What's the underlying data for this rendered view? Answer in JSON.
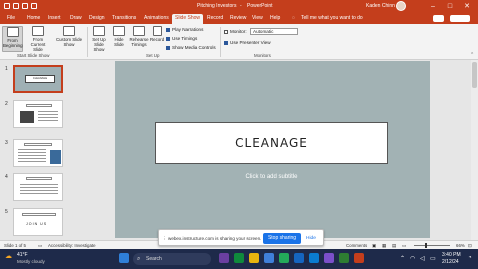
{
  "window": {
    "title": "Pitching Investors",
    "app": "PowerPoint",
    "search_text": "Tell me what you want to do",
    "user": "Kaden Chinn"
  },
  "tabs": [
    "File",
    "Home",
    "Insert",
    "Draw",
    "Design",
    "Transitions",
    "Animations",
    "Slide Show",
    "Record",
    "Review",
    "View",
    "Help"
  ],
  "ribbon": {
    "start_group": {
      "label": "Start Slide Show",
      "from_beginning": "From Beginning",
      "from_current": "From Current Slide",
      "custom": "Custom Slide Show"
    },
    "setup_group": {
      "label": "Set Up",
      "setup": "Set Up Slide Show",
      "hide": "Hide Slide",
      "rehearse": "Rehearse Timings",
      "record": "Record",
      "play_narrations": "Play Narrations",
      "use_timings": "Use Timings",
      "show_media_controls": "Show Media Controls"
    },
    "monitors_group": {
      "label": "Monitors",
      "monitor_label": "Monitor:",
      "monitor_value": "Automatic",
      "use_presenter_view": "Use Presenter View"
    }
  },
  "thumbnails": [
    {
      "num": "1",
      "title": "CLEANAGE"
    },
    {
      "num": "2",
      "title": ""
    },
    {
      "num": "3",
      "title": ""
    },
    {
      "num": "4",
      "title": ""
    },
    {
      "num": "5",
      "title": "JOIN US"
    }
  ],
  "slide": {
    "title": "CLEANAGE",
    "subtitle_placeholder": "Click to add subtitle"
  },
  "statusbar": {
    "slide_info": "Slide 1 of 5",
    "accessibility": "Accessibility: Investigate",
    "comments": "Comments",
    "zoom": "66%"
  },
  "share": {
    "message": "webex.instructure.com is sharing your screen.",
    "stop": "Stop sharing",
    "hide": "Hide"
  },
  "taskbar": {
    "temp": "41°F",
    "weather": "Mostly cloudy",
    "search": "Search",
    "time": "3:40 PM",
    "date": "2/12/24"
  },
  "colors": {
    "accent": "#c43e1c",
    "slide_bg": "#a2b2b4",
    "taskbar": "#1e2a4a"
  }
}
